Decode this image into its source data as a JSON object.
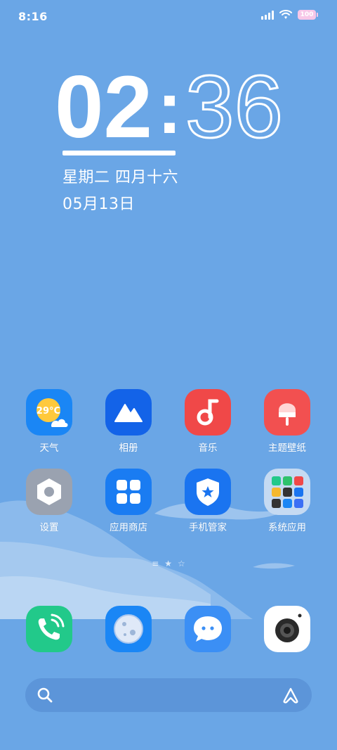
{
  "status_bar": {
    "time": "8:16",
    "battery_text": "100",
    "icons": [
      "signal-icon",
      "wifi-icon",
      "battery-icon"
    ]
  },
  "clock": {
    "hours": "02",
    "separator": ":",
    "minutes": "36"
  },
  "date": {
    "weekday_lunar": "星期二 四月十六",
    "date": "05月13日"
  },
  "apps": [
    {
      "label": "天气",
      "icon": "weather-icon",
      "badge": "29°C"
    },
    {
      "label": "相册",
      "icon": "gallery-icon"
    },
    {
      "label": "音乐",
      "icon": "music-icon"
    },
    {
      "label": "主题壁纸",
      "icon": "themes-icon"
    },
    {
      "label": "设置",
      "icon": "settings-icon"
    },
    {
      "label": "应用商店",
      "icon": "app-store-icon"
    },
    {
      "label": "手机管家",
      "icon": "phone-manager-icon"
    },
    {
      "label": "系统应用",
      "icon": "system-apps-folder-icon"
    }
  ],
  "page_indicator": [
    "≡",
    "★",
    "☆"
  ],
  "dock": [
    {
      "icon": "phone-icon"
    },
    {
      "icon": "browser-icon"
    },
    {
      "icon": "messages-icon"
    },
    {
      "icon": "camera-icon"
    }
  ],
  "search": {
    "icons": [
      "search-icon",
      "assistant-icon"
    ]
  },
  "colors": {
    "background": "#6aa6e6",
    "weather": "#1a86f5",
    "gallery": "#1363e8",
    "music": "#f04848",
    "themes": "#f25050",
    "settings": "#9aa2b0",
    "app_store": "#1a7cf2",
    "phone_manager": "#1a74f0",
    "phone": "#22c98a",
    "browser": "#1a86f5",
    "messages": "#3b8ff5"
  }
}
